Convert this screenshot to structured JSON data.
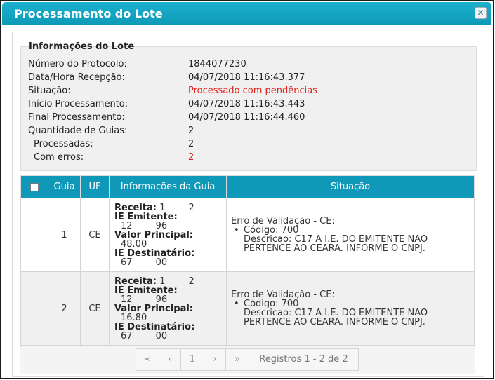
{
  "dialog": {
    "title": "Processamento do Lote",
    "close_icon": "close-icon"
  },
  "info": {
    "legend": "Informações do Lote",
    "rows": [
      {
        "label": "Número do Protocolo:",
        "value": "1844077230"
      },
      {
        "label": "Data/Hora Recepção:",
        "value": "04/07/2018 11:16:43.377"
      },
      {
        "label": "Situação:",
        "value": "Processado com pendências"
      },
      {
        "label": "Início Processamento:",
        "value": "04/07/2018 11:16:43.443"
      },
      {
        "label": "Final Processamento:",
        "value": "04/07/2018 11:16:44.460"
      },
      {
        "label": "Quantidade de Guias:",
        "value": "2"
      },
      {
        "label": "Processadas:",
        "value": "2"
      },
      {
        "label": "Com erros:",
        "value": "2"
      }
    ]
  },
  "grid": {
    "columns": [
      "Guia",
      "UF",
      "Informações da Guia",
      "Situação"
    ],
    "rows": [
      {
        "guia": "1",
        "uf": "CE",
        "receita_label": "Receita:",
        "receita_value": "1        2",
        "ie_emit_label": "IE Emitente:",
        "ie_emit_value": "12        96",
        "valor_label": "Valor Principal:",
        "valor_value": "48.00",
        "ie_dest_label": "IE Destinatário:",
        "ie_dest_value": "67        00",
        "sit_title": "Erro de Validação - CE:",
        "sit_code": "Código: 700",
        "sit_desc": "Descricao: C17 A I.E. DO EMITENTE NAO PERTENCE AO CEARA. INFORME O CNPJ."
      },
      {
        "guia": "2",
        "uf": "CE",
        "receita_label": "Receita:",
        "receita_value": "1        2",
        "ie_emit_label": "IE Emitente:",
        "ie_emit_value": "12        96",
        "valor_label": "Valor Principal:",
        "valor_value": "16.80",
        "ie_dest_label": "IE Destinatário:",
        "ie_dest_value": "67        00",
        "sit_title": "Erro de Validação - CE:",
        "sit_code": "Código: 700",
        "sit_desc": "Descricao: C17 A I.E. DO EMITENTE NAO PERTENCE AO CEARA. INFORME O CNPJ."
      }
    ]
  },
  "pager": {
    "first": "«",
    "prev": "‹",
    "page": "1",
    "next": "›",
    "last": "»",
    "records": "Registros 1 - 2 de 2"
  },
  "colors": {
    "header_bg": "#1098b8",
    "error_text": "#e0201c"
  }
}
